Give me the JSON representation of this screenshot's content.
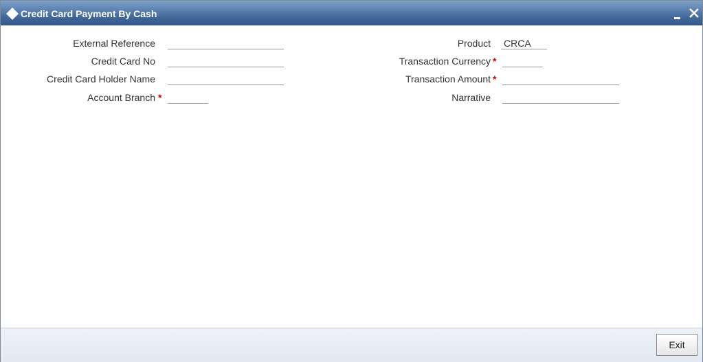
{
  "window": {
    "title": "Credit Card Payment By Cash",
    "minimize_icon": "minimize-icon",
    "close_icon": "close-icon"
  },
  "form": {
    "left": [
      {
        "label": "External Reference",
        "value": "",
        "required": false
      },
      {
        "label": "Credit Card No",
        "value": "",
        "required": false
      },
      {
        "label": "Credit Card Holder Name",
        "value": "",
        "required": false
      },
      {
        "label": "Account Branch",
        "value": "",
        "required": true
      }
    ],
    "right": [
      {
        "label": "Product",
        "value": "CRCA",
        "required": false
      },
      {
        "label": "Transaction Currency",
        "value": "",
        "required": true
      },
      {
        "label": "Transaction Amount",
        "value": "",
        "required": true
      },
      {
        "label": "Narrative",
        "value": "",
        "required": false
      }
    ],
    "required_marker": "*"
  },
  "footer": {
    "exit_label": "Exit"
  },
  "colors": {
    "titlebar": "#4a72a3",
    "required": "#cc0000"
  }
}
